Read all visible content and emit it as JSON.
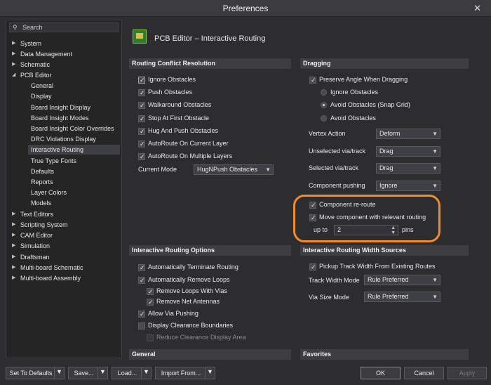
{
  "window": {
    "title": "Preferences",
    "close_glyph": "✕"
  },
  "sidebar": {
    "search_placeholder": "Search",
    "items": [
      {
        "label": "System",
        "arrow": "▶"
      },
      {
        "label": "Data Management",
        "arrow": "▶"
      },
      {
        "label": "Schematic",
        "arrow": "▶"
      },
      {
        "label": "PCB Editor",
        "arrow": "◢"
      },
      {
        "label": "General"
      },
      {
        "label": "Display"
      },
      {
        "label": "Board Insight Display"
      },
      {
        "label": "Board Insight Modes"
      },
      {
        "label": "Board Insight Color Overrides"
      },
      {
        "label": "DRC Violations Display"
      },
      {
        "label": "Interactive Routing",
        "selected": true
      },
      {
        "label": "True Type Fonts"
      },
      {
        "label": "Defaults"
      },
      {
        "label": "Reports"
      },
      {
        "label": "Layer Colors"
      },
      {
        "label": "Models"
      },
      {
        "label": "Text Editors",
        "arrow": "▶"
      },
      {
        "label": "Scripting System",
        "arrow": "▶"
      },
      {
        "label": "CAM Editor",
        "arrow": "▶"
      },
      {
        "label": "Simulation",
        "arrow": "▶"
      },
      {
        "label": "Draftsman",
        "arrow": "▶"
      },
      {
        "label": "Multi-board Schematic",
        "arrow": "▶"
      },
      {
        "label": "Multi-board Assembly",
        "arrow": "▶"
      }
    ]
  },
  "page": {
    "title": "PCB Editor – Interactive Routing"
  },
  "conflict": {
    "header": "Routing Conflict Resolution",
    "options": [
      {
        "label": "Ignore Obstacles",
        "checked": true
      },
      {
        "label": "Push Obstacles",
        "checked": true
      },
      {
        "label": "Walkaround Obstacles",
        "checked": true
      },
      {
        "label": "Stop At First Obstacle",
        "checked": true
      },
      {
        "label": "Hug And Push Obstacles",
        "checked": true
      },
      {
        "label": "AutoRoute On Current Layer",
        "checked": true
      },
      {
        "label": "AutoRoute On Multiple Layers",
        "checked": true
      }
    ],
    "current_mode_label": "Current Mode",
    "current_mode_value": "HugNPush Obstacles"
  },
  "dragging": {
    "header": "Dragging",
    "preserve_angle": "Preserve Angle When Dragging",
    "radios": [
      {
        "label": "Ignore Obstacles",
        "selected": false
      },
      {
        "label": "Avoid Obstacles (Snap Grid)",
        "selected": true
      },
      {
        "label": "Avoid Obstacles",
        "selected": false
      }
    ],
    "vertex_action_label": "Vertex Action",
    "vertex_action_value": "Deform",
    "unselected_via_label": "Unselected via/track",
    "unselected_via_value": "Drag",
    "selected_via_label": "Selected via/track",
    "selected_via_value": "Drag",
    "component_pushing_label": "Component pushing",
    "component_pushing_value": "Ignore",
    "component_reroute": "Component re-route",
    "move_component": "Move component with relevant routing",
    "up_to_label": "up to",
    "up_to_value": "2",
    "pins_label": "pins"
  },
  "routing_options": {
    "header": "Interactive Routing Options",
    "items": [
      {
        "label": "Automatically Terminate Routing",
        "checked": true
      },
      {
        "label": "Automatically Remove Loops",
        "checked": true
      },
      {
        "label": "Remove Loops With Vias",
        "checked": true
      },
      {
        "label": "Remove Net Antennas",
        "checked": true
      },
      {
        "label": "Allow Via Pushing",
        "checked": true
      },
      {
        "label": "Display Clearance Boundaries",
        "checked": false
      },
      {
        "label": "Reduce Clearance Display Area",
        "checked": false
      }
    ]
  },
  "width_sources": {
    "header": "Interactive Routing Width Sources",
    "pickup": "Pickup Track Width From Existing Routes",
    "track_width_mode_label": "Track Width Mode",
    "track_width_mode_value": "Rule Preferred",
    "via_size_mode_label": "Via Size Mode",
    "via_size_mode_value": "Rule Preferred"
  },
  "general": {
    "header": "General"
  },
  "favorites": {
    "header": "Favorites"
  },
  "footer": {
    "set_to_defaults": "Set To Defaults",
    "save": "Save...",
    "load": "Load...",
    "import_from": "Import From...",
    "ok": "OK",
    "cancel": "Cancel",
    "apply": "Apply"
  },
  "colors": {
    "highlight": "#f28c28",
    "background": "#2d2d30",
    "section_header": "#3e3e42"
  }
}
